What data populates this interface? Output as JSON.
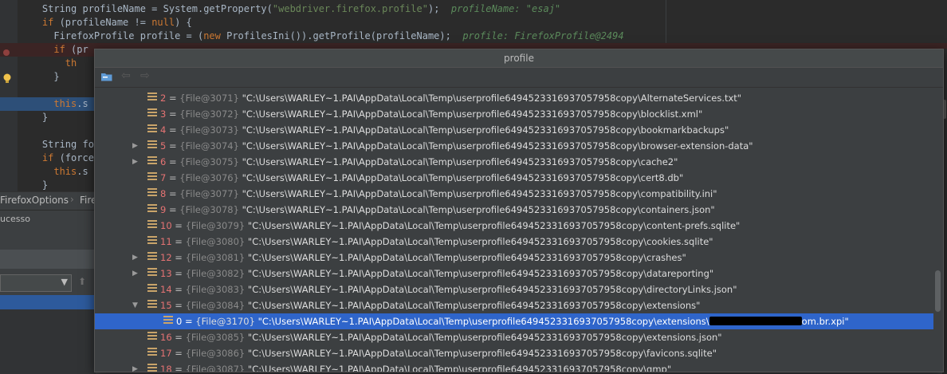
{
  "editor": {
    "lines": [
      {
        "parts": [
          {
            "t": "    String profileName = System.getProperty(",
            "c": ""
          },
          {
            "t": "\"webdriver.firefox.profile\"",
            "c": "str"
          },
          {
            "t": ");  ",
            "c": ""
          },
          {
            "t": "profileName: \"esaj\"",
            "c": "inl"
          }
        ]
      },
      {
        "parts": [
          {
            "t": "    ",
            "c": ""
          },
          {
            "t": "if",
            "c": "kw"
          },
          {
            "t": " (profileName != ",
            "c": ""
          },
          {
            "t": "null",
            "c": "kw"
          },
          {
            "t": ") {",
            "c": ""
          }
        ]
      },
      {
        "parts": [
          {
            "t": "      FirefoxProfile profile = (",
            "c": ""
          },
          {
            "t": "new",
            "c": "kw"
          },
          {
            "t": " ProfilesIni()).getProfile(profileName);  ",
            "c": ""
          },
          {
            "t": "profile: FirefoxProfile@2494",
            "c": "inl"
          }
        ]
      },
      {
        "parts": [
          {
            "t": "      ",
            "c": ""
          },
          {
            "t": "if",
            "c": "kw"
          },
          {
            "t": " (pr",
            "c": ""
          }
        ]
      },
      {
        "parts": [
          {
            "t": "        ",
            "c": ""
          },
          {
            "t": "th",
            "c": "kw"
          }
        ]
      },
      {
        "parts": [
          {
            "t": "      }",
            "c": ""
          }
        ]
      },
      {
        "parts": [
          {
            "t": "",
            "c": ""
          }
        ]
      },
      {
        "parts": [
          {
            "t": "      ",
            "c": ""
          },
          {
            "t": "this",
            "c": "kw"
          },
          {
            "t": ".s",
            "c": ""
          }
        ]
      },
      {
        "parts": [
          {
            "t": "    }",
            "c": ""
          }
        ]
      },
      {
        "parts": [
          {
            "t": "",
            "c": ""
          }
        ]
      },
      {
        "parts": [
          {
            "t": "    String for",
            "c": ""
          }
        ]
      },
      {
        "parts": [
          {
            "t": "    ",
            "c": ""
          },
          {
            "t": "if",
            "c": "kw"
          },
          {
            "t": " (forceM",
            "c": ""
          }
        ]
      },
      {
        "parts": [
          {
            "t": "      ",
            "c": ""
          },
          {
            "t": "this",
            "c": "kw"
          },
          {
            "t": ".s",
            "c": ""
          }
        ]
      },
      {
        "parts": [
          {
            "t": "    }",
            "c": ""
          }
        ]
      }
    ]
  },
  "breadcrumb": {
    "items": [
      "FirefoxOptions",
      "Fire"
    ]
  },
  "status": {
    "text": "ucesso"
  },
  "popup": {
    "title": "profile",
    "rows": [
      {
        "index": "2",
        "ref": "{File@3071}",
        "path": "\"C:\\Users\\WARLEY~1.PAI\\AppData\\Local\\Temp\\userprofile6494523316937057958copy\\AlternateServices.txt\"",
        "expandable": false,
        "level": 0
      },
      {
        "index": "3",
        "ref": "{File@3072}",
        "path": "\"C:\\Users\\WARLEY~1.PAI\\AppData\\Local\\Temp\\userprofile6494523316937057958copy\\blocklist.xml\"",
        "expandable": false,
        "level": 0
      },
      {
        "index": "4",
        "ref": "{File@3073}",
        "path": "\"C:\\Users\\WARLEY~1.PAI\\AppData\\Local\\Temp\\userprofile6494523316937057958copy\\bookmarkbackups\"",
        "expandable": false,
        "level": 0
      },
      {
        "index": "5",
        "ref": "{File@3074}",
        "path": "\"C:\\Users\\WARLEY~1.PAI\\AppData\\Local\\Temp\\userprofile6494523316937057958copy\\browser-extension-data\"",
        "expandable": true,
        "level": 0
      },
      {
        "index": "6",
        "ref": "{File@3075}",
        "path": "\"C:\\Users\\WARLEY~1.PAI\\AppData\\Local\\Temp\\userprofile6494523316937057958copy\\cache2\"",
        "expandable": true,
        "level": 0
      },
      {
        "index": "7",
        "ref": "{File@3076}",
        "path": "\"C:\\Users\\WARLEY~1.PAI\\AppData\\Local\\Temp\\userprofile6494523316937057958copy\\cert8.db\"",
        "expandable": false,
        "level": 0
      },
      {
        "index": "8",
        "ref": "{File@3077}",
        "path": "\"C:\\Users\\WARLEY~1.PAI\\AppData\\Local\\Temp\\userprofile6494523316937057958copy\\compatibility.ini\"",
        "expandable": false,
        "level": 0
      },
      {
        "index": "9",
        "ref": "{File@3078}",
        "path": "\"C:\\Users\\WARLEY~1.PAI\\AppData\\Local\\Temp\\userprofile6494523316937057958copy\\containers.json\"",
        "expandable": false,
        "level": 0
      },
      {
        "index": "10",
        "ref": "{File@3079}",
        "path": "\"C:\\Users\\WARLEY~1.PAI\\AppData\\Local\\Temp\\userprofile6494523316937057958copy\\content-prefs.sqlite\"",
        "expandable": false,
        "level": 0
      },
      {
        "index": "11",
        "ref": "{File@3080}",
        "path": "\"C:\\Users\\WARLEY~1.PAI\\AppData\\Local\\Temp\\userprofile6494523316937057958copy\\cookies.sqlite\"",
        "expandable": false,
        "level": 0
      },
      {
        "index": "12",
        "ref": "{File@3081}",
        "path": "\"C:\\Users\\WARLEY~1.PAI\\AppData\\Local\\Temp\\userprofile6494523316937057958copy\\crashes\"",
        "expandable": true,
        "level": 0
      },
      {
        "index": "13",
        "ref": "{File@3082}",
        "path": "\"C:\\Users\\WARLEY~1.PAI\\AppData\\Local\\Temp\\userprofile6494523316937057958copy\\datareporting\"",
        "expandable": true,
        "level": 0
      },
      {
        "index": "14",
        "ref": "{File@3083}",
        "path": "\"C:\\Users\\WARLEY~1.PAI\\AppData\\Local\\Temp\\userprofile6494523316937057958copy\\directoryLinks.json\"",
        "expandable": false,
        "level": 0
      },
      {
        "index": "15",
        "ref": "{File@3084}",
        "path": "\"C:\\Users\\WARLEY~1.PAI\\AppData\\Local\\Temp\\userprofile6494523316937057958copy\\extensions\"",
        "expandable": true,
        "expanded": true,
        "level": 0
      },
      {
        "index": "0",
        "ref": "{File@3170}",
        "path": "\"C:\\Users\\WARLEY~1.PAI\\AppData\\Local\\Temp\\userprofile6494523316937057958copy\\extensions\\",
        "path_tail": "om.br.xpi\"",
        "redacted": true,
        "expandable": false,
        "level": 1,
        "selected": true
      },
      {
        "index": "16",
        "ref": "{File@3085}",
        "path": "\"C:\\Users\\WARLEY~1.PAI\\AppData\\Local\\Temp\\userprofile6494523316937057958copy\\extensions.json\"",
        "expandable": false,
        "level": 0
      },
      {
        "index": "17",
        "ref": "{File@3086}",
        "path": "\"C:\\Users\\WARLEY~1.PAI\\AppData\\Local\\Temp\\userprofile6494523316937057958copy\\favicons.sqlite\"",
        "expandable": false,
        "level": 0
      },
      {
        "index": "18",
        "ref": "{File@3087}",
        "path": "\"C:\\Users\\WARLEY~1.PAI\\AppData\\Local\\Temp\\userprofile6494523316937057958copy\\gmp\"",
        "expandable": true,
        "level": 0
      }
    ]
  },
  "icons": {
    "toolbar": [
      "navigate-folder-icon",
      "back-arrow-icon",
      "forward-arrow-icon"
    ],
    "row": "field-list-icon",
    "gutter": [
      "lightbulb-icon",
      "breakpoint-icon"
    ]
  },
  "colors": {
    "background": "#2b2b2b",
    "selection": "#2f65ca",
    "index": "#e57373",
    "keyword": "#cc7832",
    "string": "#6a8759"
  }
}
